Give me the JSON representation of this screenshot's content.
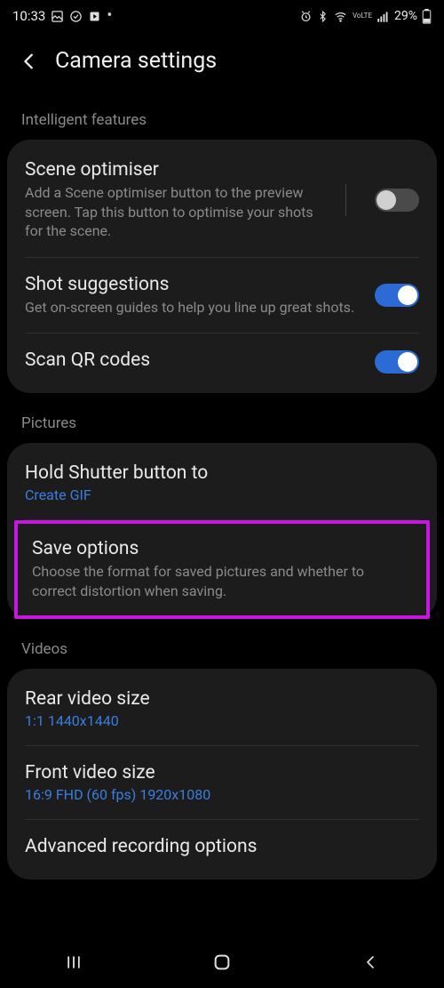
{
  "status": {
    "time": "10:33",
    "battery": "29%"
  },
  "header": {
    "title": "Camera settings"
  },
  "sections": {
    "intelligent": {
      "label": "Intelligent features",
      "scene_optimiser": {
        "title": "Scene optimiser",
        "desc": "Add a Scene optimiser button to the preview screen. Tap this button to optimise your shots for the scene."
      },
      "shot_suggestions": {
        "title": "Shot suggestions",
        "desc": "Get on-screen guides to help you line up great shots."
      },
      "scan_qr": {
        "title": "Scan QR codes"
      }
    },
    "pictures": {
      "label": "Pictures",
      "hold_shutter": {
        "title": "Hold Shutter button to",
        "value": "Create GIF"
      },
      "save_options": {
        "title": "Save options",
        "desc": "Choose the format for saved pictures and whether to correct distortion when saving."
      }
    },
    "videos": {
      "label": "Videos",
      "rear": {
        "title": "Rear video size",
        "value": "1:1 1440x1440"
      },
      "front": {
        "title": "Front video size",
        "value": "16:9 FHD (60 fps) 1920x1080"
      },
      "advanced": {
        "title": "Advanced recording options"
      }
    }
  }
}
